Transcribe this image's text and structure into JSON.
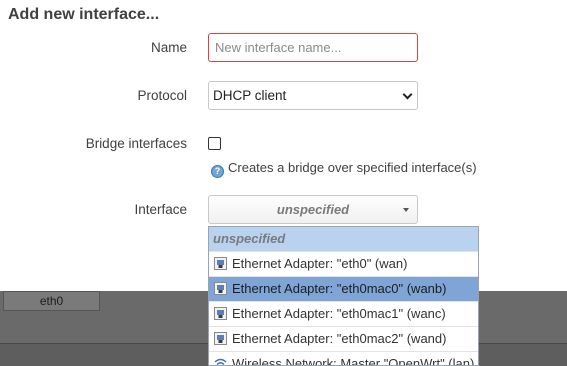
{
  "dialog": {
    "title": "Add new interface...",
    "name_label": "Name",
    "name_placeholder": "New interface name...",
    "protocol_label": "Protocol",
    "protocol_value": "DHCP client",
    "bridge_label": "Bridge interfaces",
    "bridge_help": "Creates a bridge over specified interface(s)",
    "interface_label": "Interface",
    "interface_value": "unspecified"
  },
  "dropdown": {
    "header": "unspecified",
    "items": [
      {
        "label": "Ethernet Adapter: \"eth0\" (wan)",
        "icon": "ethernet-port-icon",
        "highlighted": false
      },
      {
        "label": "Ethernet Adapter: \"eth0mac0\" (wanb)",
        "icon": "ethernet-port-icon",
        "highlighted": true
      },
      {
        "label": "Ethernet Adapter: \"eth0mac1\" (wanc)",
        "icon": "ethernet-port-icon",
        "highlighted": false
      },
      {
        "label": "Ethernet Adapter: \"eth0mac2\" (wand)",
        "icon": "ethernet-port-icon",
        "highlighted": false
      },
      {
        "label": "Wireless Network: Master \"OpenWrt\" (lan)",
        "icon": "wifi-icon",
        "highlighted": false
      }
    ]
  },
  "background": {
    "tab_label": "eth0"
  },
  "colors": {
    "error_border": "#e0413f",
    "highlight": "#7fa5d6",
    "dropdown_header": "#b9d2f0",
    "overlay": "#5e5e5e"
  }
}
